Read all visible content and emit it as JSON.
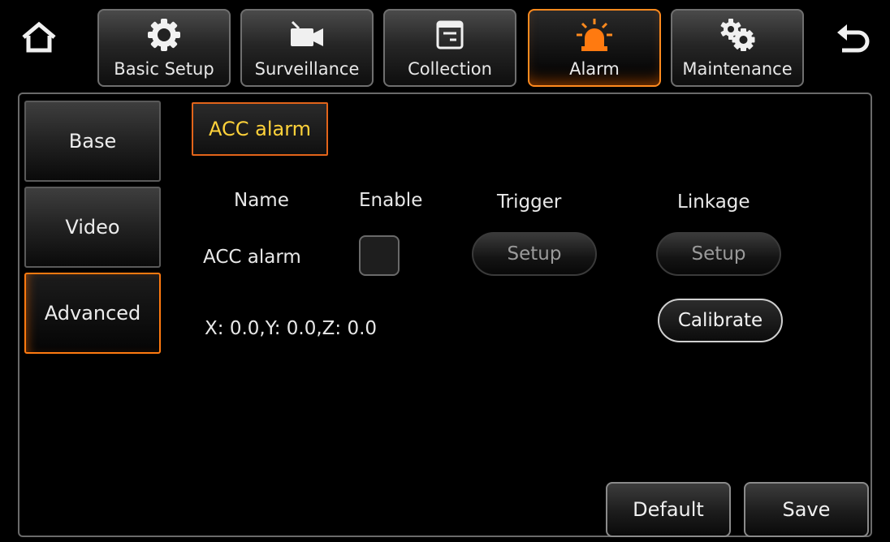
{
  "nav": {
    "tabs": [
      {
        "label": "Basic Setup",
        "icon": "gear-icon"
      },
      {
        "label": "Surveillance",
        "icon": "video-camera-icon"
      },
      {
        "label": "Collection",
        "icon": "document-icon"
      },
      {
        "label": "Alarm",
        "icon": "siren-icon",
        "active": true
      },
      {
        "label": "Maintenance",
        "icon": "gears-icon"
      }
    ]
  },
  "sidebar": {
    "items": [
      {
        "label": "Base"
      },
      {
        "label": "Video"
      },
      {
        "label": "Advanced",
        "active": true
      }
    ]
  },
  "main": {
    "subtab": "ACC alarm",
    "columns": {
      "name": "Name",
      "enable": "Enable",
      "trigger": "Trigger",
      "linkage": "Linkage"
    },
    "row": {
      "name": "ACC alarm",
      "enabled": false,
      "trigger_button": "Setup",
      "linkage_button": "Setup"
    },
    "coordinates": "X: 0.0,Y: 0.0,Z: 0.0",
    "calibrate_button": "Calibrate"
  },
  "footer": {
    "default_button": "Default",
    "save_button": "Save"
  },
  "colors": {
    "accent": "#ff8a1e",
    "subtab_text": "#ffd23a",
    "background": "#000000"
  }
}
